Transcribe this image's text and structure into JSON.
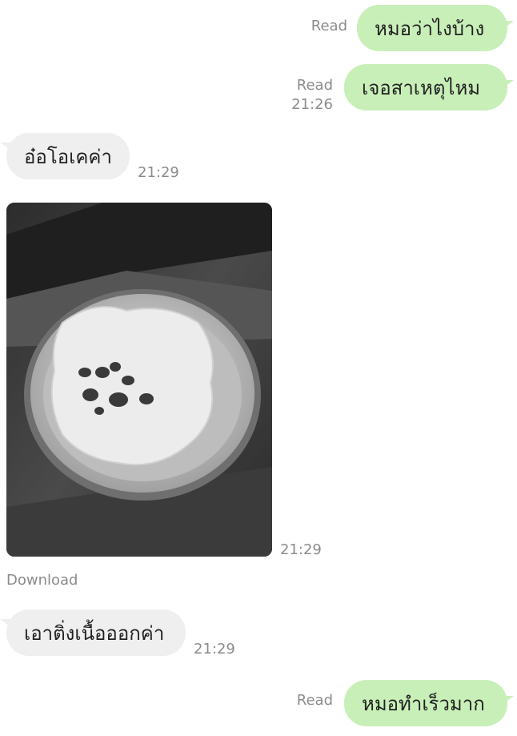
{
  "messages": [
    {
      "id": "m1",
      "side": "out",
      "text": "หมอว่าไงบ้าง",
      "status": "Read",
      "time": ""
    },
    {
      "id": "m2",
      "side": "out",
      "text": "เจอสาเหตุไหม",
      "status": "Read",
      "time": "21:26"
    },
    {
      "id": "m3",
      "side": "in",
      "text": "อ๋อโอเคค่า",
      "time": "21:29"
    },
    {
      "id": "m4",
      "side": "in",
      "type": "image",
      "image_icon": "photo-of-metal-bowl-with-gauze",
      "time": "21:29",
      "download_label": "Download"
    },
    {
      "id": "m5",
      "side": "in",
      "text": "เอาติ่งเนื้อออกค่า",
      "time": "21:29"
    },
    {
      "id": "m6",
      "side": "out",
      "text": "หมอทำเร็วมาก",
      "status": "Read",
      "time": ""
    }
  ],
  "colors": {
    "outgoing_bubble": "#c9efb9",
    "incoming_bubble": "#efefef",
    "meta_text": "#8c8c8c",
    "background": "#ffffff"
  }
}
